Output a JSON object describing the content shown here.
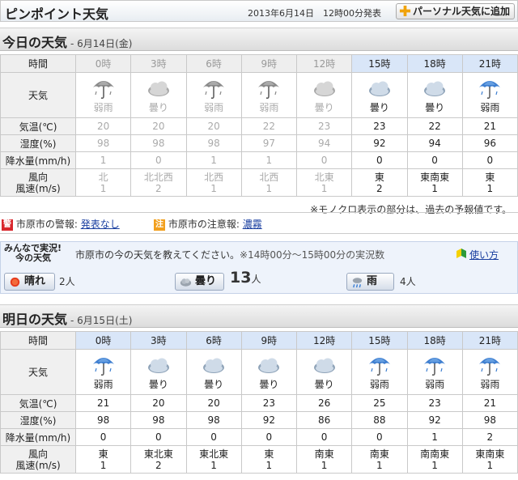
{
  "header": {
    "title": "ピンポイント天気",
    "stamp": "2013年6月14日　12時00分発表",
    "add_button": "パーソナル天気に追加"
  },
  "today": {
    "title": "今日の天気",
    "date": "- 6月14日(金)",
    "labels": {
      "time": "時間",
      "weather": "天気",
      "temp": "気温(℃)",
      "humidity": "湿度(%)",
      "precip": "降水量(mm/h)",
      "wind_dir": "風向",
      "wind_speed": "風速(m/s)"
    },
    "hours": [
      "0時",
      "3時",
      "6時",
      "9時",
      "12時",
      "15時",
      "18時",
      "21時"
    ],
    "future_from": 5,
    "icons": [
      "umbrella-icon",
      "cloud-icon",
      "umbrella-icon",
      "umbrella-icon",
      "cloud-icon",
      "cloud-icon",
      "cloud-icon",
      "umbrella-icon"
    ],
    "weather": [
      "弱雨",
      "曇り",
      "弱雨",
      "弱雨",
      "曇り",
      "曇り",
      "曇り",
      "弱雨"
    ],
    "temp": [
      "20",
      "20",
      "20",
      "22",
      "23",
      "23",
      "22",
      "21"
    ],
    "humidity": [
      "98",
      "98",
      "98",
      "97",
      "94",
      "92",
      "94",
      "96"
    ],
    "precip": [
      "1",
      "0",
      "1",
      "1",
      "0",
      "0",
      "0",
      "0"
    ],
    "wind_dir": [
      "北",
      "北北西",
      "北西",
      "北西",
      "北東",
      "東",
      "東南東",
      "東"
    ],
    "wind_speed": [
      "1",
      "2",
      "1",
      "1",
      "1",
      "2",
      "1",
      "1"
    ]
  },
  "note": "※モノクロ表示の部分は、過去の予報値です。",
  "alerts": {
    "warn_icon": "警",
    "warn_label": "市原市の警報:",
    "warn_value": "発表なし",
    "adv_icon": "注",
    "adv_label": "市原市の注意報:",
    "adv_value": "濃霧"
  },
  "report": {
    "logo_line1": "みんなで実況!",
    "logo_line2": "今の天気",
    "prompt": "市原市の今の天気を教えてください。",
    "period": "※14時00分～15時00分の実況数",
    "help": "使い方",
    "sunny": "晴れ",
    "sunny_count": "2人",
    "cloudy": "曇り",
    "cloudy_count_num": "13",
    "cloudy_count_unit": "人",
    "rain": "雨",
    "rain_count": "4人"
  },
  "tomorrow": {
    "title": "明日の天気",
    "date": "- 6月15日(土)",
    "hours": [
      "0時",
      "3時",
      "6時",
      "9時",
      "12時",
      "15時",
      "18時",
      "21時"
    ],
    "icons": [
      "umbrella-icon",
      "cloud-icon",
      "cloud-icon",
      "cloud-icon",
      "cloud-icon",
      "umbrella-icon",
      "umbrella-icon",
      "umbrella-icon"
    ],
    "weather": [
      "弱雨",
      "曇り",
      "曇り",
      "曇り",
      "曇り",
      "弱雨",
      "弱雨",
      "弱雨"
    ],
    "temp": [
      "21",
      "20",
      "20",
      "23",
      "26",
      "25",
      "23",
      "21"
    ],
    "humidity": [
      "98",
      "98",
      "98",
      "92",
      "86",
      "88",
      "92",
      "98"
    ],
    "precip": [
      "0",
      "0",
      "0",
      "0",
      "0",
      "0",
      "1",
      "2"
    ],
    "wind_dir": [
      "東",
      "東北東",
      "東北東",
      "東",
      "南東",
      "南東",
      "南南東",
      "東南東"
    ],
    "wind_speed": [
      "1",
      "2",
      "1",
      "1",
      "1",
      "1",
      "1",
      "1"
    ]
  }
}
